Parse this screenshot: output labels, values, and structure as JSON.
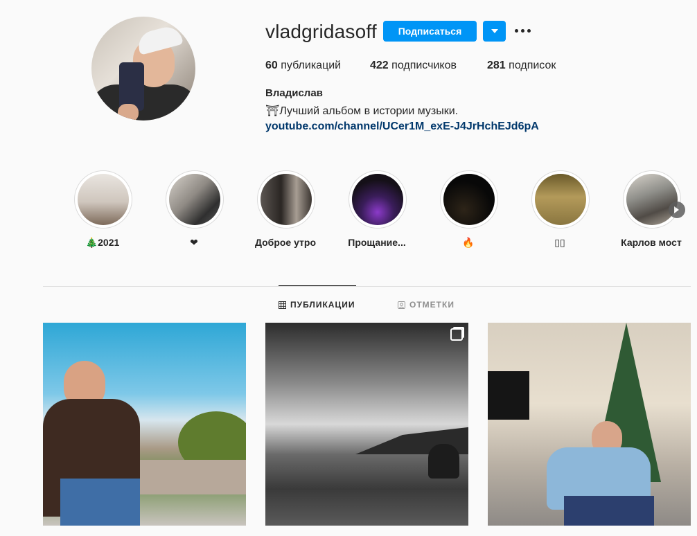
{
  "profile": {
    "username": "vladgridasoff",
    "follow_label": "Подписаться",
    "full_name": "Владислав",
    "bio": "⛩Лучший альбом в истории музыки.",
    "link": "youtube.com/channel/UCer1M_exE-J4JrHchEJd6pA"
  },
  "stats": {
    "posts_count": "60",
    "posts_label": "публикаций",
    "followers_count": "422",
    "followers_label": "подписчиков",
    "following_count": "281",
    "following_label": "подписок"
  },
  "highlights": [
    {
      "label": "🎄2021"
    },
    {
      "label": "❤"
    },
    {
      "label": "Доброе утро"
    },
    {
      "label": "Прощание..."
    },
    {
      "label": "🔥"
    },
    {
      "label": "▯▯"
    },
    {
      "label": "Карлов мост"
    }
  ],
  "tabs": {
    "posts": "ПУБЛИКАЦИИ",
    "tagged": "ОТМЕТКИ"
  },
  "colors": {
    "accent": "#0095f6",
    "link": "#00376b",
    "text": "#262626",
    "background": "#fafafa"
  }
}
